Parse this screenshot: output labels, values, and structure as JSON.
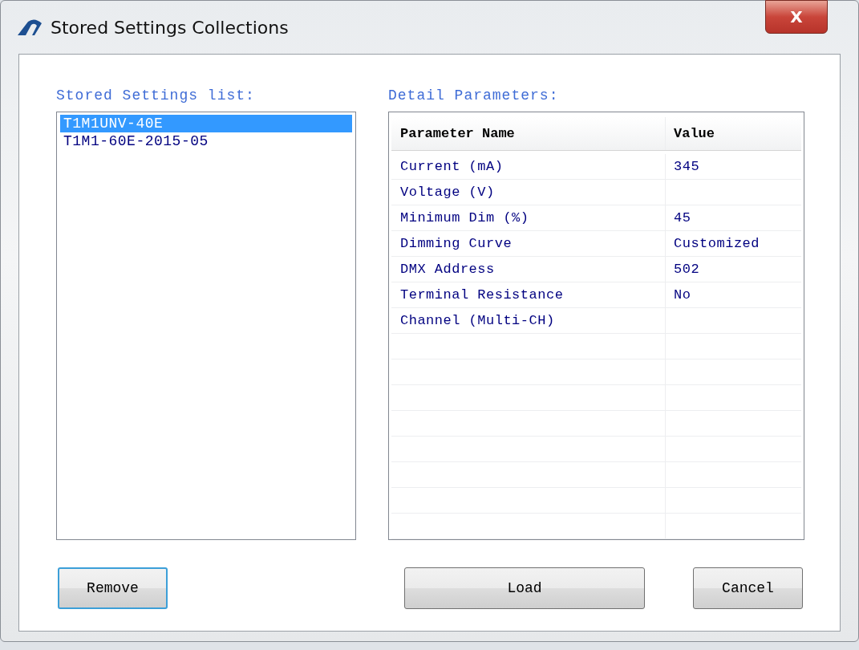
{
  "window": {
    "title": "Stored Settings Collections",
    "close_label": "X"
  },
  "stored_list": {
    "label": "Stored Settings list:",
    "items": [
      {
        "text": "T1M1UNV-40E",
        "selected": true
      },
      {
        "text": "T1M1-60E-2015-05",
        "selected": false
      }
    ]
  },
  "detail": {
    "label": "Detail Parameters:",
    "columns": [
      "Parameter Name",
      "Value"
    ],
    "rows": [
      {
        "name": "Current (mA)",
        "value": "345"
      },
      {
        "name": "Voltage (V)",
        "value": ""
      },
      {
        "name": "Minimum Dim (%)",
        "value": "45"
      },
      {
        "name": "Dimming Curve",
        "value": "Customized"
      },
      {
        "name": "DMX Address",
        "value": "502"
      },
      {
        "name": "Terminal Resistance",
        "value": "No"
      },
      {
        "name": "Channel (Multi-CH)",
        "value": ""
      }
    ]
  },
  "buttons": [
    {
      "label": "Remove",
      "focused": true
    },
    {
      "label": "Load",
      "focused": false
    },
    {
      "label": "Cancel",
      "focused": false
    }
  ]
}
